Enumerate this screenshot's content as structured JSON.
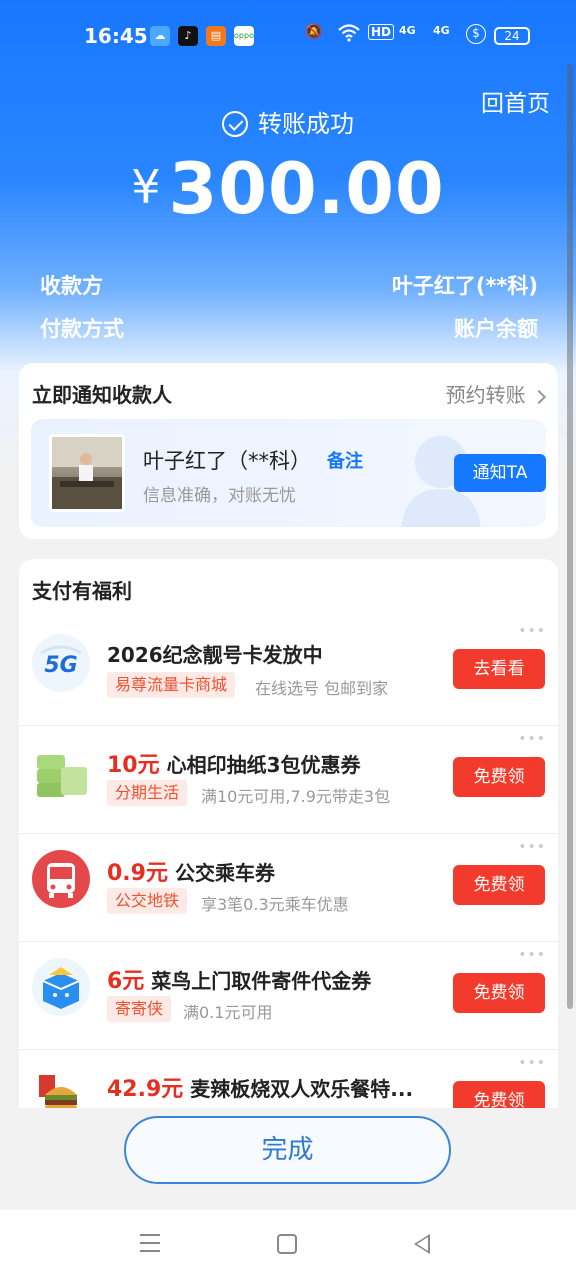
{
  "status_bar": {
    "time": "16:45",
    "hd": "HD",
    "signal1": "4G",
    "signal2": "4G",
    "battery": "24"
  },
  "header": {
    "home_link": "回首页",
    "status_text": "转账成功",
    "currency": "¥",
    "amount": "300.00"
  },
  "info": {
    "payee_label": "收款方",
    "payee_value": "叶子红了(**科)",
    "payment_label": "付款方式",
    "payment_value": "账户余额"
  },
  "notify_card": {
    "title": "立即通知收款人",
    "schedule_link": "预约转账",
    "payee_name": "叶子红了（**科）",
    "note_label": "备注",
    "subtitle": "信息准确，对账无忧",
    "notify_button": "通知TA"
  },
  "benefits": {
    "title": "支付有福利",
    "items": [
      {
        "icon": "5g-icon",
        "price": "",
        "title": "2026纪念靓号卡发放中",
        "tag": "易尊流量卡商城",
        "desc": "在线选号  包邮到家",
        "button": "去看看"
      },
      {
        "icon": "tissue-icon",
        "price": "10元",
        "title": "心相印抽纸3包优惠券",
        "tag": "分期生活",
        "desc": "满10元可用,7.9元带走3包",
        "button": "免费领"
      },
      {
        "icon": "bus-icon",
        "price": "0.9元",
        "title": "公交乘车券",
        "tag": "公交地铁",
        "desc": "享3笔0.3元乘车优惠",
        "button": "免费领"
      },
      {
        "icon": "parcel-icon",
        "price": "6元",
        "title": "菜鸟上门取件寄件代金券",
        "tag": "寄寄侠",
        "desc": "满0.1元可用",
        "button": "免费领"
      },
      {
        "icon": "burger-icon",
        "price": "42.9元",
        "title": "麦辣板烧双人欢乐餐特...",
        "tag": "",
        "desc": "",
        "button": "免费领"
      }
    ]
  },
  "footer": {
    "done_button": "完成"
  },
  "colors": {
    "brand_blue": "#1677ff",
    "red": "#f23b2d"
  }
}
